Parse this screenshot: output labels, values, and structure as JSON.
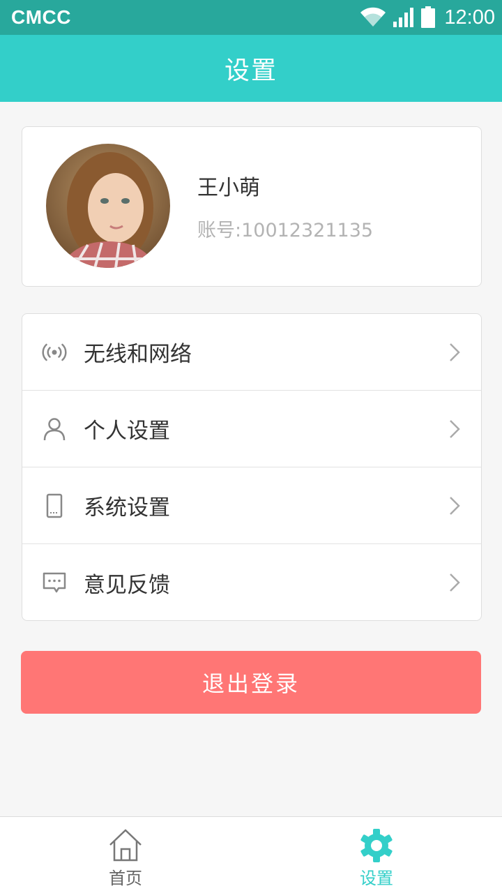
{
  "status_bar": {
    "carrier": "CMCC",
    "time": "12:00"
  },
  "header": {
    "title": "设置"
  },
  "profile": {
    "name": "王小萌",
    "account": "账号:10012321135"
  },
  "menu": {
    "items": [
      {
        "label": "无线和网络",
        "icon": "wireless-icon"
      },
      {
        "label": "个人设置",
        "icon": "person-icon"
      },
      {
        "label": "系统设置",
        "icon": "phone-icon"
      },
      {
        "label": "意见反馈",
        "icon": "feedback-icon"
      }
    ]
  },
  "logout": {
    "label": "退出登录"
  },
  "tabs": [
    {
      "label": "首页",
      "icon": "home-icon",
      "active": false
    },
    {
      "label": "设置",
      "icon": "gear-icon",
      "active": true
    }
  ],
  "colors": {
    "status_bar": "#28a89c",
    "accent": "#33cfc9",
    "logout": "#ff7675",
    "background": "#f6f6f6"
  }
}
